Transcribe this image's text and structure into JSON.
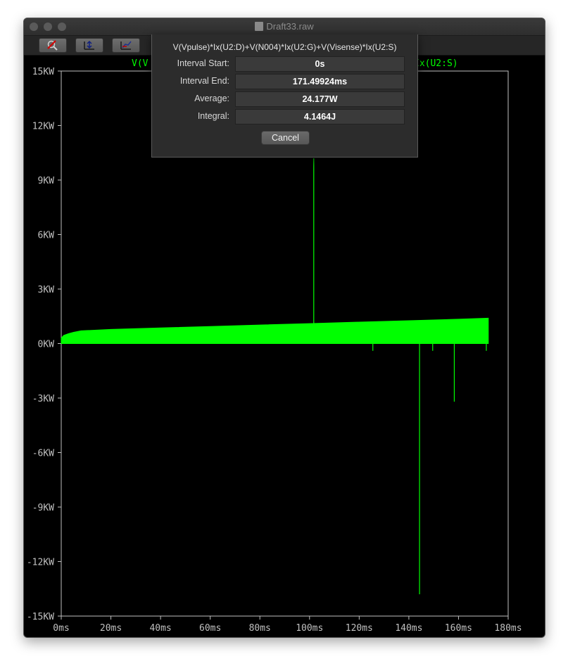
{
  "window": {
    "title": "Draft33.raw",
    "toolbar": {
      "buttons": [
        {
          "name": "zoom-cancel-icon"
        },
        {
          "name": "autorange-y-icon"
        },
        {
          "name": "pan-icon"
        }
      ]
    }
  },
  "plot": {
    "trace_label_left": "V(V",
    "trace_label_right": "Ix(U2:S)",
    "trace_color": "#00ff00",
    "axis_color": "#c0c0c0"
  },
  "dialog": {
    "title": "V(Vpulse)*Ix(U2:D)+V(N004)*Ix(U2:G)+V(Visense)*Ix(U2:S)",
    "rows": [
      {
        "label": "Interval Start:",
        "value": "0s"
      },
      {
        "label": "Interval End:",
        "value": "171.49924ms"
      },
      {
        "label": "Average:",
        "value": "24.177W"
      },
      {
        "label": "Integral:",
        "value": "4.1464J"
      }
    ],
    "cancel_label": "Cancel"
  },
  "chart_data": {
    "type": "line",
    "title": "",
    "xlabel": "",
    "ylabel": "",
    "x_ticks": [
      "0ms",
      "20ms",
      "40ms",
      "60ms",
      "80ms",
      "100ms",
      "120ms",
      "140ms",
      "160ms",
      "180ms"
    ],
    "y_ticks": [
      "15KW",
      "12KW",
      "9KW",
      "6KW",
      "3KW",
      "0KW",
      "-3KW",
      "-6KW",
      "-9KW",
      "-12KW",
      "-15KW"
    ],
    "xlim": [
      0,
      180
    ],
    "ylim": [
      -15,
      15
    ],
    "x_unit": "ms",
    "y_unit": "KW",
    "envelope": {
      "x": [
        0,
        1,
        3,
        5,
        8,
        20,
        40,
        60,
        80,
        100,
        120,
        140,
        160,
        172
      ],
      "upper": [
        0.3,
        0.45,
        0.55,
        0.62,
        0.7,
        0.78,
        0.86,
        0.94,
        1.02,
        1.1,
        1.18,
        1.26,
        1.34,
        1.4
      ],
      "lower": [
        0,
        0,
        0,
        0,
        0,
        0,
        0,
        0,
        0,
        0,
        0,
        0,
        0,
        0
      ]
    },
    "spikes": [
      {
        "x": 101.7,
        "y": 10.2
      },
      {
        "x": 125.5,
        "y": -0.4
      },
      {
        "x": 144.3,
        "y": -13.8
      },
      {
        "x": 149.6,
        "y": -0.4
      },
      {
        "x": 158.3,
        "y": -3.2
      },
      {
        "x": 171.2,
        "y": -0.4
      }
    ]
  }
}
